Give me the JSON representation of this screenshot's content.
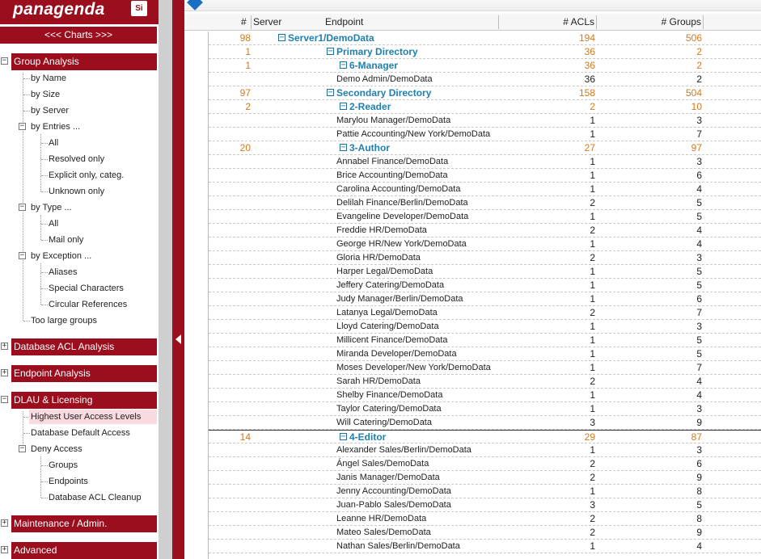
{
  "logo": {
    "word": "panagenda",
    "badge": "Si"
  },
  "sidebar": {
    "charts_label": "<<< Charts >>>",
    "group_analysis": {
      "title": "Group Analysis",
      "by_name": "by Name",
      "by_size": "by Size",
      "by_server": "by Server",
      "by_entries": "by Entries ...",
      "entries": [
        "All",
        "Resolved only",
        "Explicit only, categ.",
        "Unknown only"
      ],
      "by_type": "by Type ...",
      "types": [
        "All",
        "Mail only"
      ],
      "by_exception": "by Exception ...",
      "exceptions": [
        "Aliases",
        "Special Characters",
        "Circular References"
      ],
      "too_large": "Too large groups"
    },
    "database_acl": {
      "title": "Database ACL Analysis"
    },
    "endpoint": {
      "title": "Endpoint Analysis"
    },
    "dlau": {
      "title": "DLAU & Licensing",
      "highest": "Highest User Access Levels",
      "default": "Database Default Access",
      "deny": "Deny Access",
      "deny_items": [
        "Groups",
        "Endpoints",
        "Database ACL Cleanup"
      ]
    },
    "maintenance": {
      "title": "Maintenance / Admin."
    },
    "advanced": {
      "title": "Advanced"
    }
  },
  "grid": {
    "headers": {
      "count": "#",
      "server": "Server",
      "endpoint": "Endpoint",
      "acls": "# ACLs",
      "groups": "# Groups"
    },
    "rows": [
      {
        "t": "g",
        "lvl": 0,
        "count": "98",
        "name": "Server1/DemoData",
        "acls": "194",
        "groups": "506"
      },
      {
        "t": "g",
        "lvl": 1,
        "count": "1",
        "name": "Primary Directory",
        "acls": "36",
        "groups": "2"
      },
      {
        "t": "g",
        "lvl": 2,
        "count": "1",
        "name": "6-Manager",
        "acls": "36",
        "groups": "2"
      },
      {
        "t": "e",
        "name": "Demo Admin/DemoData",
        "acls": "36",
        "groups": "2"
      },
      {
        "t": "g",
        "lvl": 1,
        "count": "97",
        "name": "Secondary Directory",
        "acls": "158",
        "groups": "504"
      },
      {
        "t": "g",
        "lvl": 2,
        "count": "2",
        "name": "2-Reader",
        "acls": "2",
        "groups": "10"
      },
      {
        "t": "e",
        "name": "Marylou Manager/DemoData",
        "acls": "1",
        "groups": "3"
      },
      {
        "t": "e",
        "name": "Pattie Accounting/New York/DemoData",
        "acls": "1",
        "groups": "7"
      },
      {
        "t": "g",
        "lvl": 2,
        "count": "20",
        "name": "3-Author",
        "acls": "27",
        "groups": "97"
      },
      {
        "t": "e",
        "name": "Annabel Finance/DemoData",
        "acls": "1",
        "groups": "3"
      },
      {
        "t": "e",
        "name": "Brice Accounting/DemoData",
        "acls": "1",
        "groups": "6"
      },
      {
        "t": "e",
        "name": "Carolina Accounting/DemoData",
        "acls": "1",
        "groups": "4"
      },
      {
        "t": "e",
        "name": "Delilah Finance/Berlin/DemoData",
        "acls": "2",
        "groups": "5"
      },
      {
        "t": "e",
        "name": "Evangeline Developer/DemoData",
        "acls": "1",
        "groups": "5"
      },
      {
        "t": "e",
        "name": "Freddie HR/DemoData",
        "acls": "2",
        "groups": "4"
      },
      {
        "t": "e",
        "name": "George HR/New York/DemoData",
        "acls": "1",
        "groups": "4"
      },
      {
        "t": "e",
        "name": "Gloria HR/DemoData",
        "acls": "2",
        "groups": "3"
      },
      {
        "t": "e",
        "name": "Harper Legal/DemoData",
        "acls": "1",
        "groups": "5"
      },
      {
        "t": "e",
        "name": "Jeffery Catering/DemoData",
        "acls": "1",
        "groups": "5"
      },
      {
        "t": "e",
        "name": "Judy Manager/Berlin/DemoData",
        "acls": "1",
        "groups": "6"
      },
      {
        "t": "e",
        "name": "Latanya Legal/DemoData",
        "acls": "2",
        "groups": "7"
      },
      {
        "t": "e",
        "name": "Lloyd Catering/DemoData",
        "acls": "1",
        "groups": "3"
      },
      {
        "t": "e",
        "name": "Millicent Finance/DemoData",
        "acls": "1",
        "groups": "5"
      },
      {
        "t": "e",
        "name": "Miranda Developer/DemoData",
        "acls": "1",
        "groups": "5"
      },
      {
        "t": "e",
        "name": "Moses Developer/New York/DemoData",
        "acls": "1",
        "groups": "7"
      },
      {
        "t": "e",
        "name": "Sarah HR/DemoData",
        "acls": "2",
        "groups": "4"
      },
      {
        "t": "e",
        "name": "Shelby Finance/DemoData",
        "acls": "1",
        "groups": "4"
      },
      {
        "t": "e",
        "name": "Taylor Catering/DemoData",
        "acls": "1",
        "groups": "3"
      },
      {
        "t": "e",
        "name": "Will Catering/DemoData",
        "acls": "3",
        "groups": "9"
      },
      {
        "t": "g",
        "lvl": 2,
        "count": "14",
        "name": "4-Editor",
        "acls": "29",
        "groups": "87",
        "solidtop": true
      },
      {
        "t": "e",
        "name": "Alexander Sales/Berlin/DemoData",
        "acls": "1",
        "groups": "3"
      },
      {
        "t": "e",
        "name": "Ángel Sales/DemoData",
        "acls": "2",
        "groups": "6"
      },
      {
        "t": "e",
        "name": "Janis Manager/DemoData",
        "acls": "2",
        "groups": "9"
      },
      {
        "t": "e",
        "name": "Jenny Accounting/DemoData",
        "acls": "1",
        "groups": "8"
      },
      {
        "t": "e",
        "name": "Juan-Pablo Sales/DemoData",
        "acls": "3",
        "groups": "5"
      },
      {
        "t": "e",
        "name": "Leanne HR/DemoData",
        "acls": "2",
        "groups": "8"
      },
      {
        "t": "e",
        "name": "Mateo Sales/DemoData",
        "acls": "2",
        "groups": "9"
      },
      {
        "t": "e",
        "name": "Nathan Sales/Berlin/DemoData",
        "acls": "1",
        "groups": "4"
      }
    ]
  }
}
